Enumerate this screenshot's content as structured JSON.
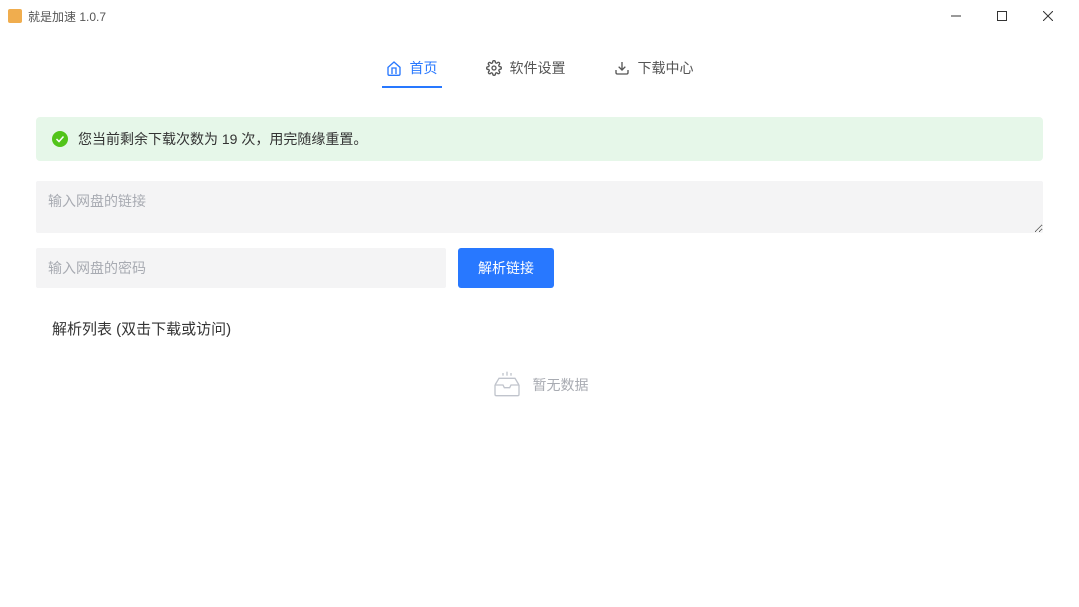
{
  "titlebar": {
    "title": "就是加速  1.0.7"
  },
  "tabs": [
    {
      "label": "首页",
      "active": true
    },
    {
      "label": "软件设置",
      "active": false
    },
    {
      "label": "下载中心",
      "active": false
    }
  ],
  "alert": {
    "text": "您当前剩余下载次数为 19 次，用完随缘重置。"
  },
  "inputs": {
    "link_placeholder": "输入网盘的链接",
    "password_placeholder": "输入网盘的密码",
    "parse_button": "解析链接"
  },
  "list": {
    "title": "解析列表 (双击下载或访问)",
    "empty_text": "暂无数据"
  }
}
